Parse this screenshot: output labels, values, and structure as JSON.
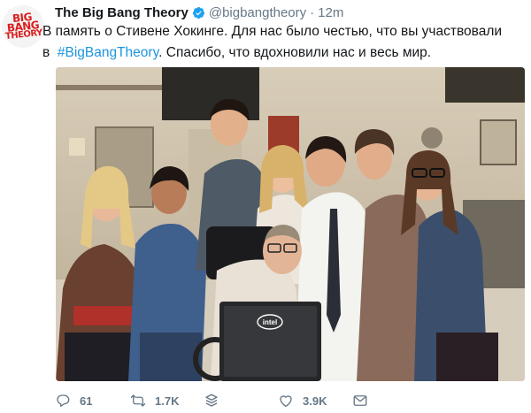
{
  "tweet": {
    "author_name": "The Big Bang Theory",
    "handle": "@bigbangtheory",
    "separator": "·",
    "time": "12m",
    "avatar_line1": "BIG",
    "avatar_line2": "BANG",
    "avatar_line3": "THEORY",
    "text_line1": "В память о Стивене Хокинге. Для нас было честью, что вы участвовали",
    "text_prefix": "в",
    "hashtag": "#BigBangTheory",
    "text_suffix": ". Спасибо, что вдохновили нас и весь мир.",
    "photo_laptop_brand": "intel"
  },
  "actions": {
    "reply_count": "61",
    "retweet_count": "1.7K",
    "like_count": "3.9K"
  },
  "colors": {
    "link": "#1b95e0",
    "secondary_text": "#657786",
    "verified": "#1da1f2",
    "brand_red": "#d9201f"
  },
  "icons": [
    "verified-badge-icon",
    "reply-icon",
    "retweet-icon",
    "stack-icon",
    "like-icon",
    "dm-icon"
  ]
}
